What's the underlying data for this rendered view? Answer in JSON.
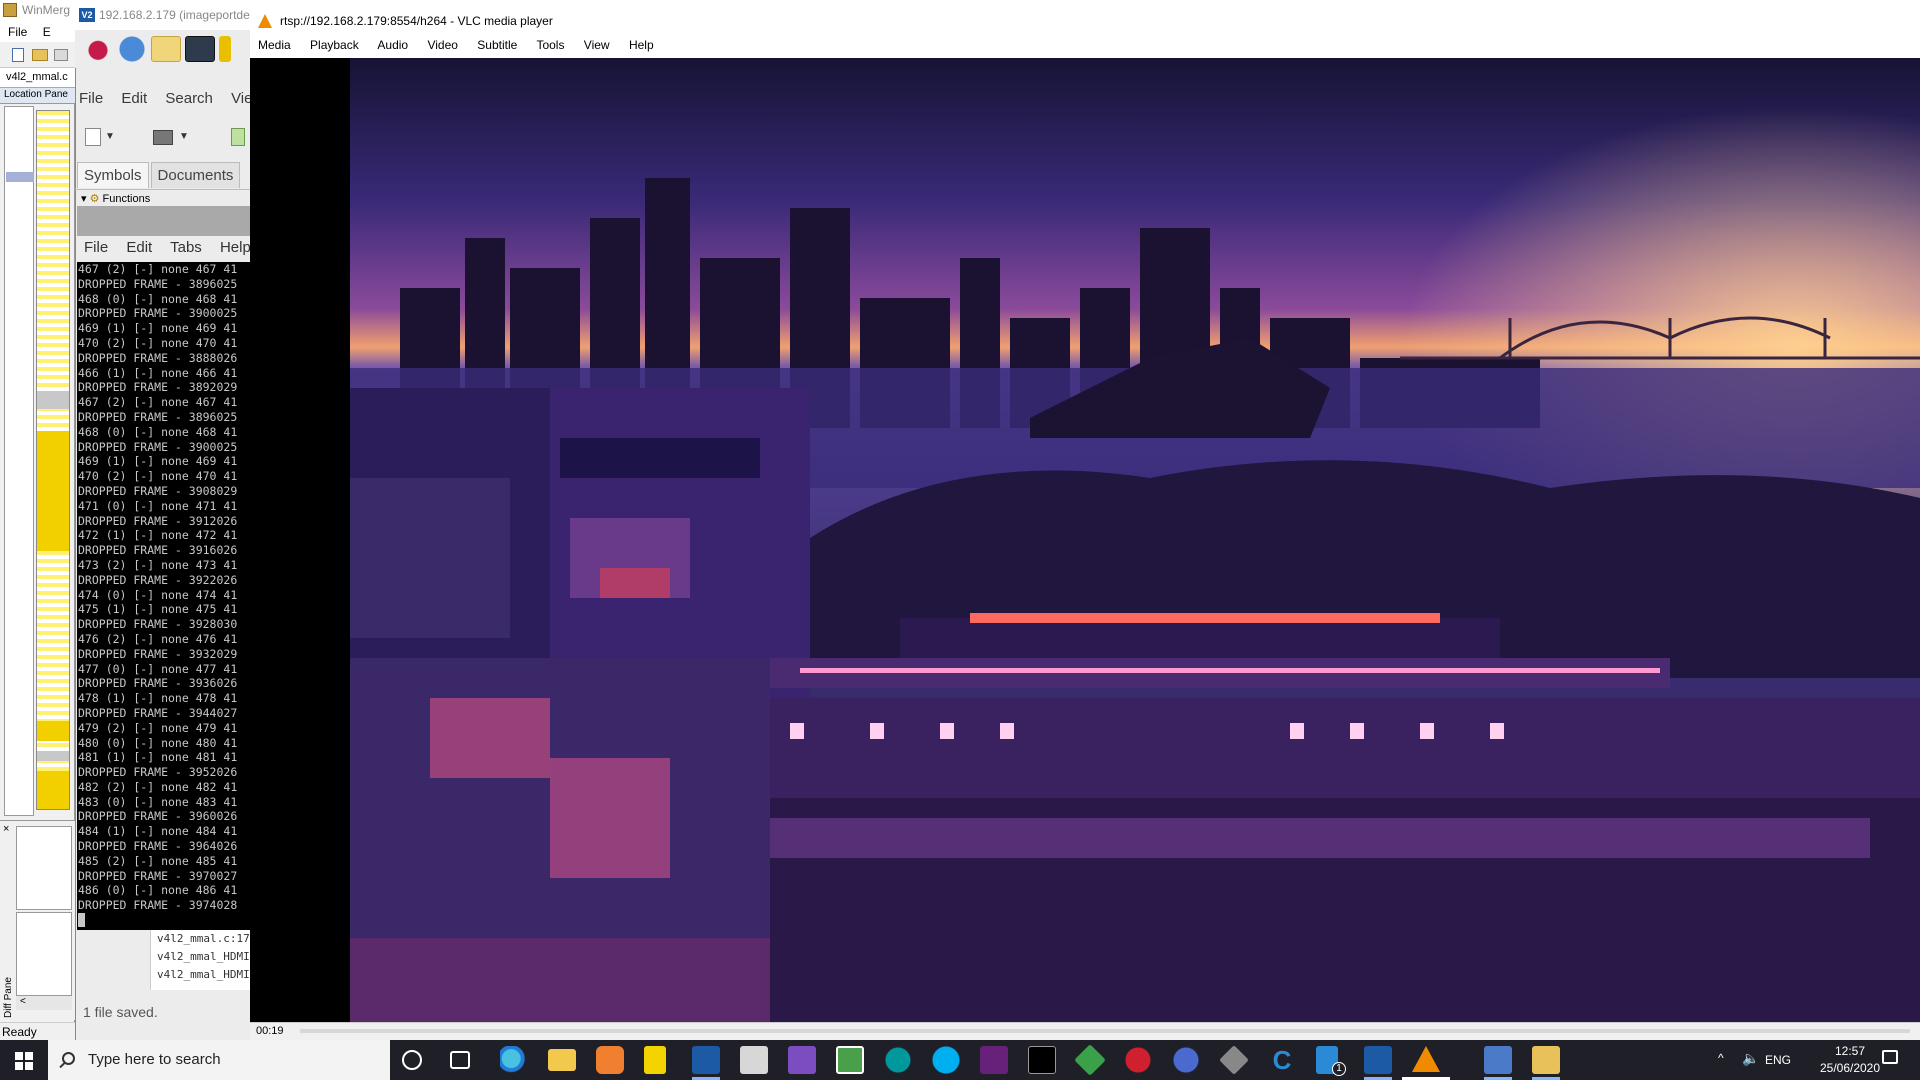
{
  "winmerge": {
    "title": "WinMerg",
    "menu": [
      "File",
      "E"
    ],
    "tab": "v4l2_mmal.c",
    "location_pane": "Location Pane",
    "diff_pane": "Diff Pane",
    "diff_close": "×",
    "scroll_left": "<",
    "status": "Ready"
  },
  "vnc": {
    "title": "192.168.2.179 (imageportdev",
    "logo_text": "V2"
  },
  "geany": {
    "menu": [
      "File",
      "Edit",
      "Search",
      "View"
    ],
    "tabs": [
      "Symbols",
      "Documents"
    ],
    "functions_label": "Functions",
    "list_items": [
      "v4l2_mmal.c:17",
      "v4l2_mmal_HDMI",
      "v4l2_mmal_HDMI"
    ],
    "status": "1 file saved."
  },
  "terminal": {
    "menu": [
      "File",
      "Edit",
      "Tabs",
      "Help"
    ],
    "lines": [
      "467 (2) [-] none 467 41",
      "DROPPED FRAME - 3896025",
      "468 (0) [-] none 468 41",
      "DROPPED FRAME - 3900025",
      "469 (1) [-] none 469 41",
      "470 (2) [-] none 470 41",
      "DROPPED FRAME - 3888026",
      "466 (1) [-] none 466 41",
      "DROPPED FRAME - 3892029",
      "467 (2) [-] none 467 41",
      "DROPPED FRAME - 3896025",
      "468 (0) [-] none 468 41",
      "DROPPED FRAME - 3900025",
      "469 (1) [-] none 469 41",
      "470 (2) [-] none 470 41",
      "DROPPED FRAME - 3908029",
      "471 (0) [-] none 471 41",
      "DROPPED FRAME - 3912026",
      "472 (1) [-] none 472 41",
      "DROPPED FRAME - 3916026",
      "473 (2) [-] none 473 41",
      "DROPPED FRAME - 3922026",
      "474 (0) [-] none 474 41",
      "475 (1) [-] none 475 41",
      "DROPPED FRAME - 3928030",
      "476 (2) [-] none 476 41",
      "DROPPED FRAME - 3932029",
      "477 (0) [-] none 477 41",
      "DROPPED FRAME - 3936026",
      "478 (1) [-] none 478 41",
      "DROPPED FRAME - 3944027",
      "479 (2) [-] none 479 41",
      "480 (0) [-] none 480 41",
      "481 (1) [-] none 481 41",
      "DROPPED FRAME - 3952026",
      "482 (2) [-] none 482 41",
      "483 (0) [-] none 483 41",
      "DROPPED FRAME - 3960026",
      "484 (1) [-] none 484 41",
      "DROPPED FRAME - 3964026",
      "485 (2) [-] none 485 41",
      "DROPPED FRAME - 3970027",
      "486 (0) [-] none 486 41",
      "DROPPED FRAME - 3974028"
    ]
  },
  "vlc": {
    "title": "rtsp://192.168.2.179:8554/h264 - VLC media player",
    "menu": [
      "Media",
      "Playback",
      "Audio",
      "Video",
      "Subtitle",
      "Tools",
      "View",
      "Help"
    ],
    "time": "00:19"
  },
  "taskbar": {
    "search_placeholder": "Type here to search",
    "language": "ENG",
    "time": "12:57",
    "date": "25/06/2020",
    "tray_caret": "^",
    "volume_icon": "🔈",
    "badge_count": "1",
    "colors": {
      "taskbar_bg": "#1f1f28",
      "active_indicator": "#8ab4f8"
    }
  }
}
